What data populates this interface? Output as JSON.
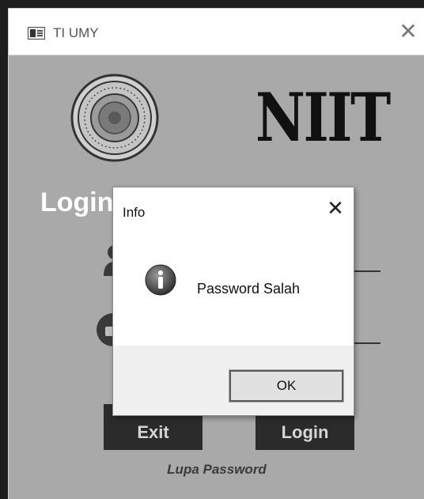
{
  "window": {
    "title": "TI UMY",
    "close_icon": "close-icon"
  },
  "branding": {
    "logo_text": "NIIT",
    "seal_icon": "university-seal-icon"
  },
  "form": {
    "heading": "Login",
    "user_icon": "user-icon",
    "password_icon": "lock-icon",
    "exit_label": "Exit",
    "login_label": "Login",
    "forgot_password": "Lupa Password"
  },
  "dialog": {
    "title": "Info",
    "message": "Password Salah",
    "ok_label": "OK",
    "icon": "info-icon"
  },
  "colors": {
    "background": "#a9a9a9",
    "button": "#2b2b2b",
    "heading": "#ffffff"
  }
}
